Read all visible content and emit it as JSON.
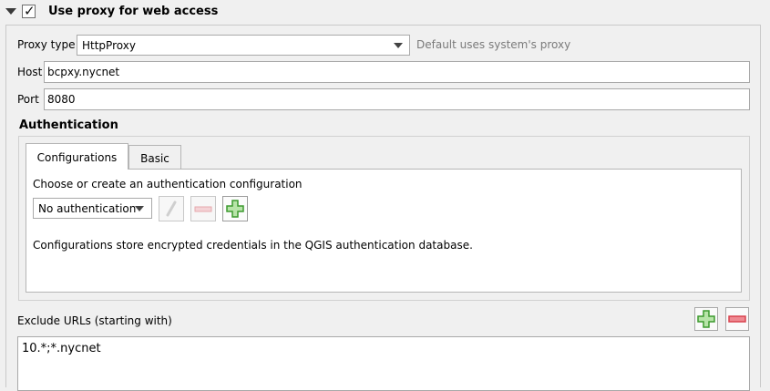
{
  "group": {
    "title": "Use proxy for web access",
    "checked": "✓"
  },
  "proxy": {
    "type_label": "Proxy type",
    "type_value": "HttpProxy",
    "type_hint": "Default uses system's proxy",
    "host_label": "Host",
    "host_value": "bcpxy.nycnet",
    "port_label": "Port",
    "port_value": "8080"
  },
  "auth": {
    "title": "Authentication",
    "tabs": [
      {
        "label": "Configurations",
        "active": true
      },
      {
        "label": "Basic",
        "active": false
      }
    ],
    "choose_label": "Choose or create an authentication configuration",
    "config_select": "No authentication",
    "info": "Configurations store encrypted credentials in the QGIS authentication database.",
    "icons": [
      "edit-icon",
      "remove-icon",
      "add-icon"
    ]
  },
  "exclude": {
    "label": "Exclude URLs (starting with)",
    "value": "10.*;*.nycnet"
  },
  "colors": {
    "add_green": "#3c9a2e",
    "remove_red": "#d9434e"
  }
}
